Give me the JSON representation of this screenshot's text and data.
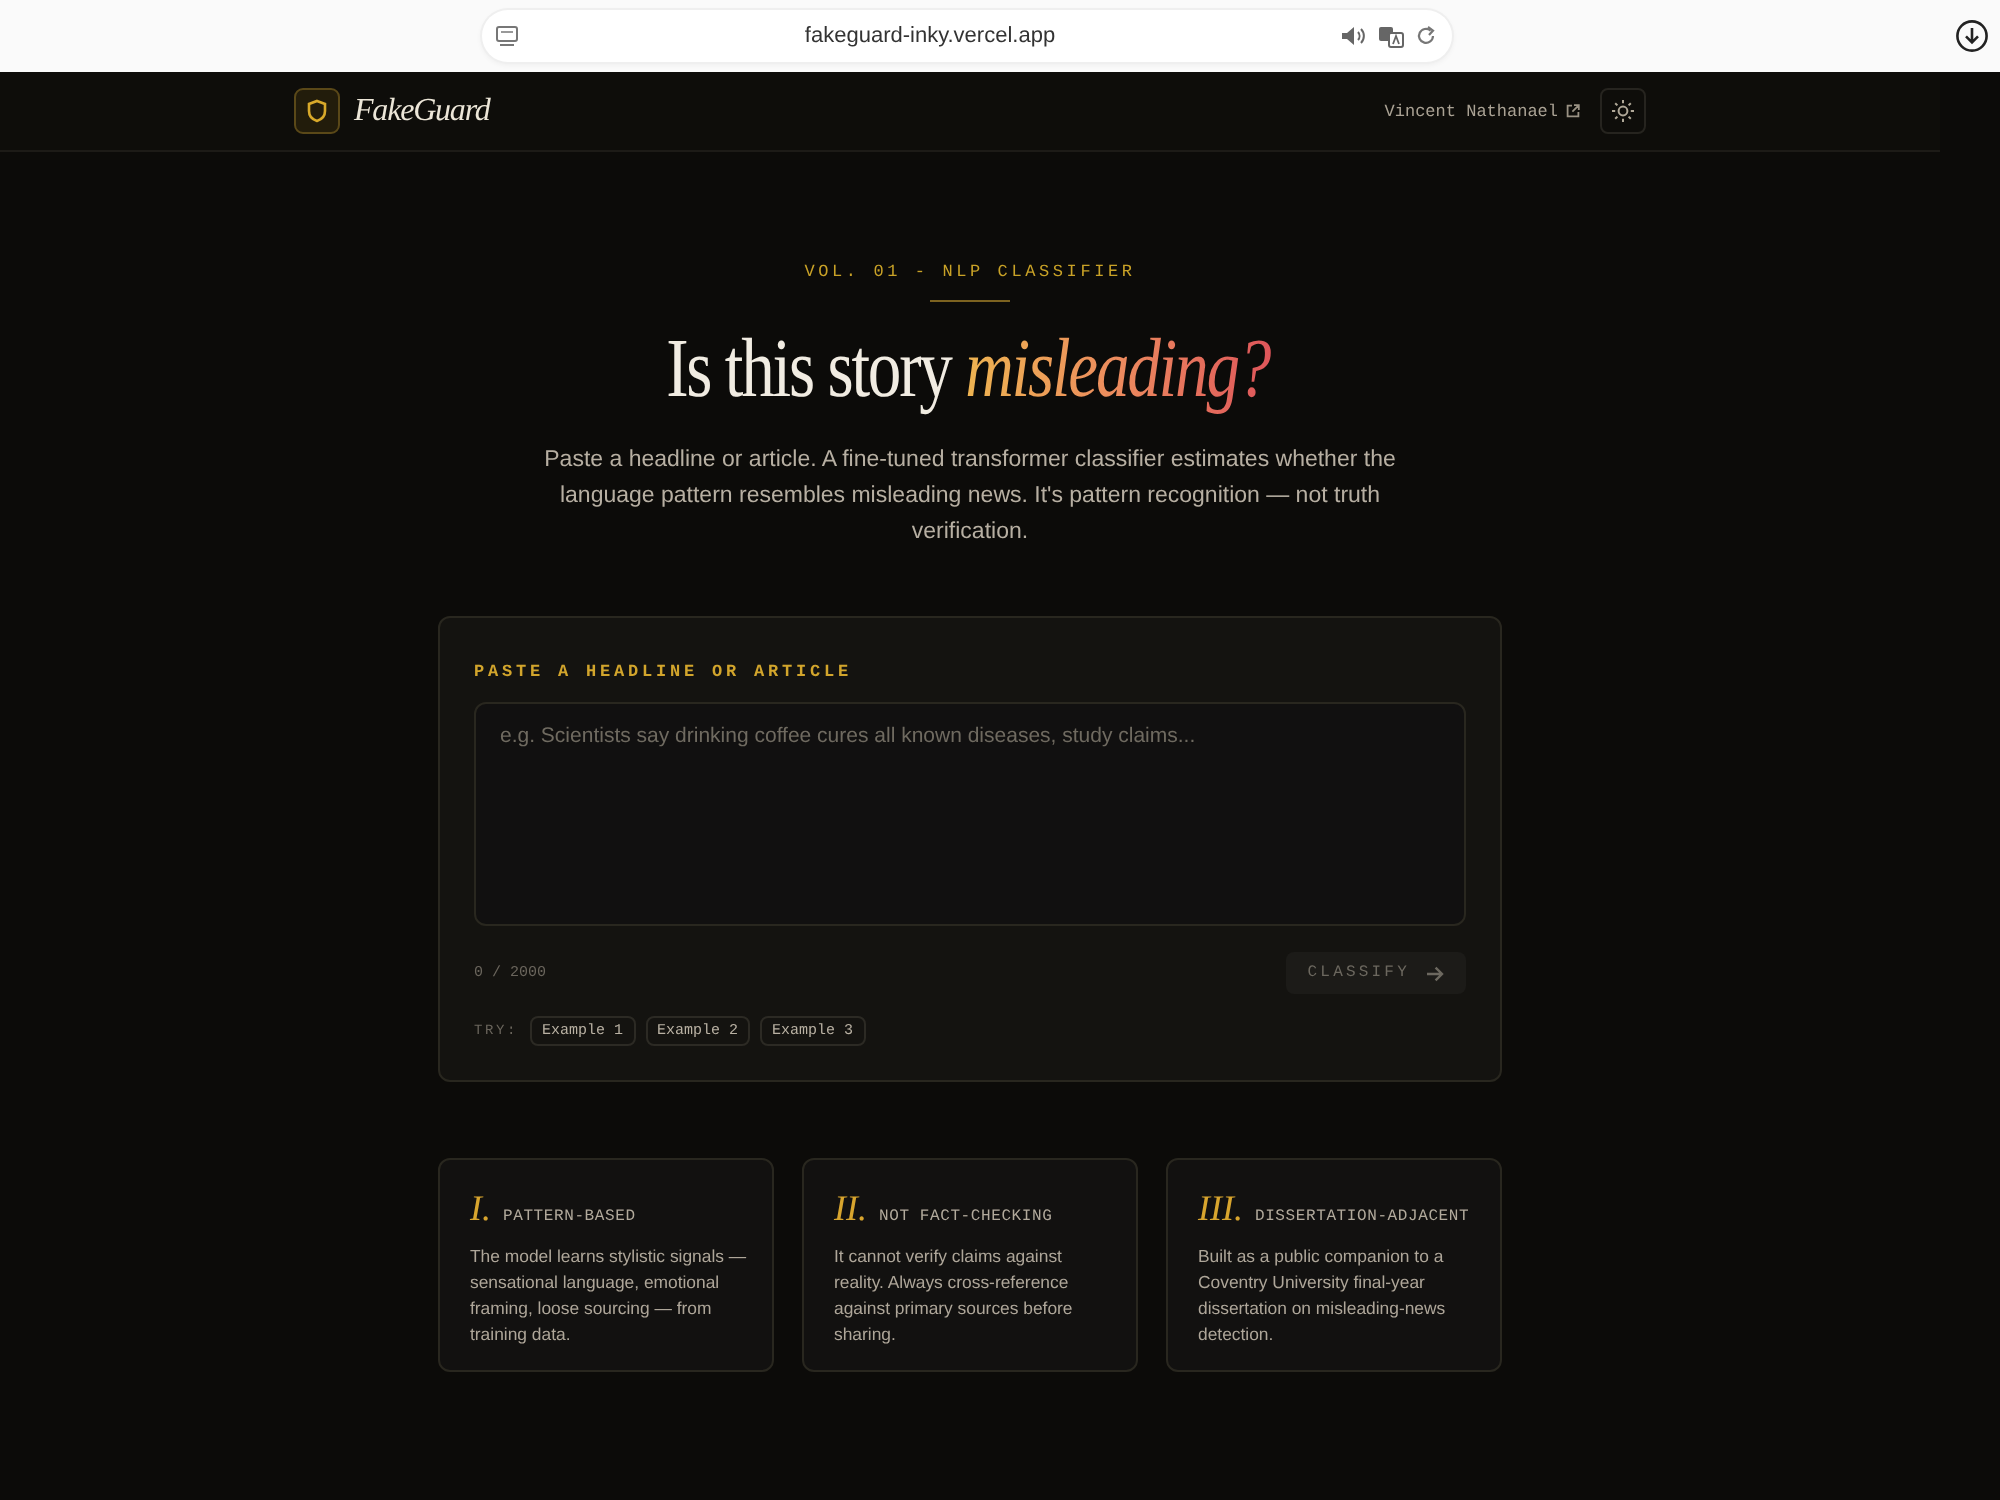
{
  "browser": {
    "url": "fakeguard-inky.vercel.app"
  },
  "header": {
    "brand": "FakeGuard",
    "author": "Vincent Nathanael"
  },
  "hero": {
    "eyebrow": "VOL. 01 - NLP CLASSIFIER",
    "title": "Is this story *misleading?*",
    "intro": "Paste a headline or article. A fine-tuned transformer classifier estimates whether the language pattern resembles misleading news. It's pattern recognition — not truth verification."
  },
  "classifier": {
    "label": "PASTE A HEADLINE OR ARTICLE",
    "input": {
      "placeholder": "e.g. Scientists say drinking coffee cures all known diseases, study claims..."
    },
    "counter": "0 / 2000",
    "classify_button": {
      "label": "CLASSIFY",
      "disabled": true
    },
    "try_label": "TRY:",
    "examples": [
      "Example 1",
      "Example 2",
      "Example 3"
    ]
  },
  "features": [
    {
      "numeral": "I.",
      "title": "PATTERN-BASED",
      "body": "The model learns stylistic signals — sensational language, emotional framing, loose sourcing — from training data."
    },
    {
      "numeral": "II.",
      "title": "NOT FACT-CHECKING",
      "body": "It cannot verify claims against reality. Always cross-reference against primary sources before sharing."
    },
    {
      "numeral": "III.",
      "title": "DISSERTATION-ADJACENT",
      "body": "Built as a public companion to a Coventry University final-year dissertation on misleading-news detection."
    }
  ]
}
